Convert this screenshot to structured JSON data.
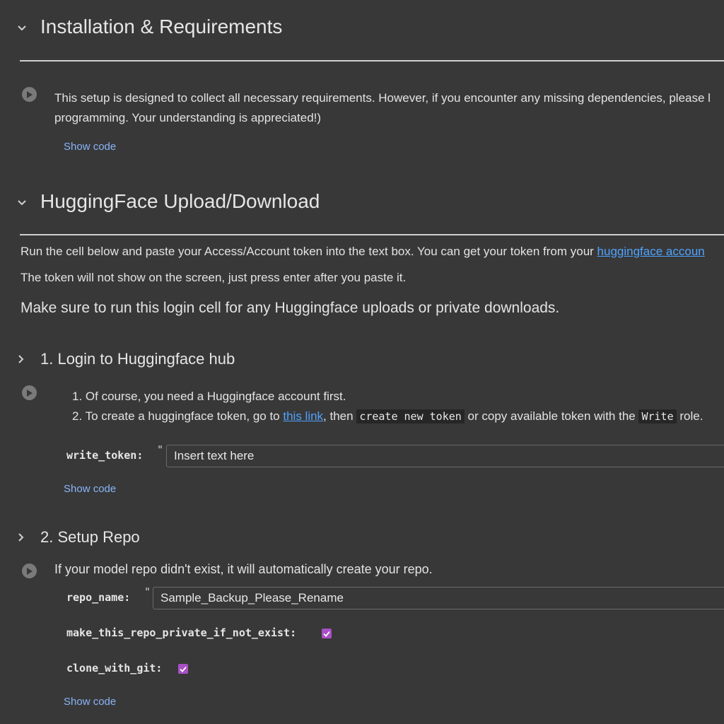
{
  "section_install": {
    "title": "Installation & Requirements",
    "description_line1": "This setup is designed to collect all necessary requirements. However, if you encounter any missing dependencies, please l",
    "description_line2": "programming. Your understanding is appreciated!)",
    "show_code": "Show code"
  },
  "section_hf": {
    "title": "HuggingFace Upload/Download",
    "intro_prefix": "Run the cell below and paste your Access/Account token into the text box. You can get your token from your ",
    "intro_link": "huggingface accoun",
    "token_note": "The token will not show on the screen, just press enter after you paste it.",
    "login_reminder": "Make sure to run this login cell for any Huggingface uploads or private downloads."
  },
  "login_section": {
    "title": "1. Login to Huggingface hub",
    "step1": "1. Of course, you need a Huggingface account first.",
    "step2_prefix": "2. To create a huggingface token, go to ",
    "step2_link": "this link",
    "step2_mid": ", then ",
    "step2_code1": "create new token",
    "step2_mid2": " or copy available token with the ",
    "step2_code2": "Write",
    "step2_suffix": " role.",
    "param_label": "write_token:",
    "quote_mark": "\"",
    "input_placeholder": "Insert text here",
    "show_code": "Show code"
  },
  "repo_section": {
    "title": "2. Setup Repo",
    "description": "If your model repo didn't exist, it will automatically create your repo.",
    "repo_name_label": "repo_name:",
    "quote_mark": "\"",
    "repo_name_value": "Sample_Backup_Please_Rename",
    "private_label": "make_this_repo_private_if_not_exist:",
    "private_checked": true,
    "clone_label": "clone_with_git:",
    "clone_checked": true,
    "show_code": "Show code"
  },
  "colors": {
    "background": "#383838",
    "link": "#4fa3ff",
    "show_code": "#8ab4f8",
    "checkbox": "#a94fc7"
  }
}
